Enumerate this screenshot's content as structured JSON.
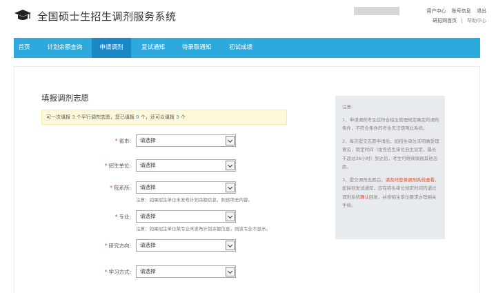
{
  "header": {
    "title": "全国硕士生招生调剂服务系统",
    "logo_icon": "graduation-cap-icon",
    "top_links": {
      "user_center": "用户中心",
      "account_info": "账号信息",
      "logout": "退出",
      "yz_home": "研招网首页",
      "separator": "|",
      "help": "帮助中心"
    }
  },
  "nav": {
    "color": "#2da9de",
    "active_color": "#1b88c5",
    "items": [
      {
        "label": "首页"
      },
      {
        "label": "计划余额查询"
      },
      {
        "label": "申请调剂"
      },
      {
        "label": "复试通知"
      },
      {
        "label": "待录取通知"
      },
      {
        "label": "初试成绩"
      }
    ],
    "active_index": 2
  },
  "form": {
    "title": "填报调剂志愿",
    "notice": {
      "part1": "可一次填报",
      "n1": "3",
      "part2": "个平行调剂志愿，您已填报",
      "n2": "0",
      "part3": "个，还可以填报",
      "n3": "3",
      "part4": "个"
    },
    "fields": [
      {
        "label": "省市:",
        "value": "请选择",
        "note": ""
      },
      {
        "label": "招生单位:",
        "value": "请选择",
        "note": ""
      },
      {
        "label": "院系所:",
        "value": "请选择",
        "note": "注意：如果招生单位未发布计划余额信息，则该项无内容。"
      },
      {
        "label": "专业:",
        "value": "请选择",
        "note": "注意：如果招生单位某专业未发布计划余额信息，则该专业不显示。"
      },
      {
        "label": "研究方向:",
        "value": "请选择",
        "note": ""
      },
      {
        "label": "学习方式:",
        "value": "请选择",
        "note": ""
      }
    ],
    "required_mark": "*"
  },
  "side_panel": {
    "heading": "注意:",
    "p1": "1、申请调剂考生应符合招生管理规定确定的调剂条件，不符合条件的考生无法使用此系统。",
    "p2": "2、每次提交志愿申请后，如招生单位未明确受理意见，锁定时间（由各招生单位自主设定，最长不超过36小时）到达后，考生可继续填报其他志愿。",
    "p3_a": "3、提交调剂志愿后，",
    "p3_red1": "请及时登录调剂系统查看",
    "p3_b": "，如接到复试通知，应在招生单位规定时间内通过调剂系统",
    "p3_red2": "确认",
    "p3_c": "回复，并按招生单位要求办理相关手续。"
  }
}
